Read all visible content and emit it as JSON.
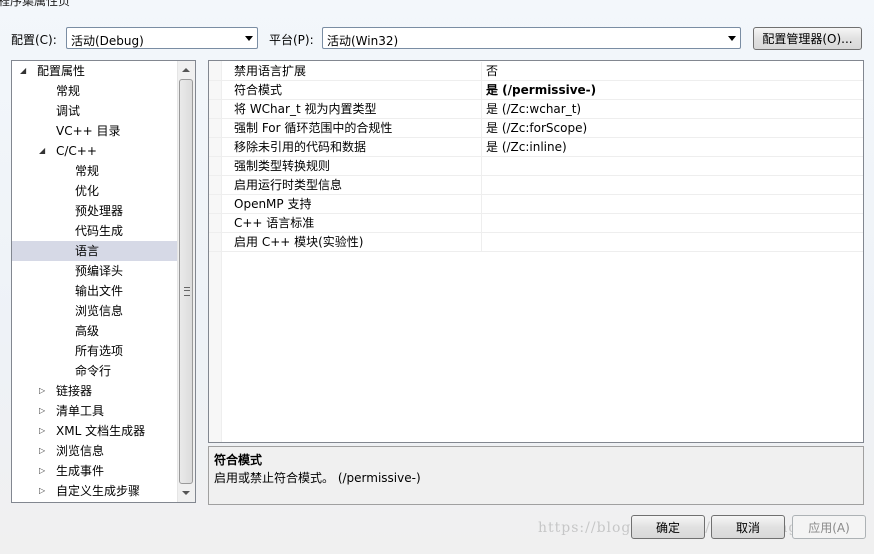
{
  "window": {
    "title": "程序集属性页"
  },
  "toolbar": {
    "config_label": "配置(C):",
    "config_value": "活动(Debug)",
    "platform_label": "平台(P):",
    "platform_value": "活动(Win32)",
    "config_manager_label": "配置管理器(O)..."
  },
  "tree": {
    "items": [
      {
        "label": "配置属性",
        "expander": "◢"
      },
      {
        "label": "常规"
      },
      {
        "label": "调试"
      },
      {
        "label": "VC++ 目录"
      },
      {
        "label": "C/C++",
        "expander": "◢"
      },
      {
        "label": "常规"
      },
      {
        "label": "优化"
      },
      {
        "label": "预处理器"
      },
      {
        "label": "代码生成"
      },
      {
        "label": "语言"
      },
      {
        "label": "预编译头"
      },
      {
        "label": "输出文件"
      },
      {
        "label": "浏览信息"
      },
      {
        "label": "高级"
      },
      {
        "label": "所有选项"
      },
      {
        "label": "命令行"
      },
      {
        "label": "链接器",
        "expander": "▷"
      },
      {
        "label": "清单工具",
        "expander": "▷"
      },
      {
        "label": "XML 文档生成器",
        "expander": "▷"
      },
      {
        "label": "浏览信息",
        "expander": "▷"
      },
      {
        "label": "生成事件",
        "expander": "▷"
      },
      {
        "label": "自定义生成步骤",
        "expander": "▷"
      }
    ]
  },
  "grid": {
    "rows": [
      {
        "name": "禁用语言扩展",
        "value": "否"
      },
      {
        "name": "符合模式",
        "value": "是 (/permissive-)"
      },
      {
        "name": "将 WChar_t 视为内置类型",
        "value": "是 (/Zc:wchar_t)"
      },
      {
        "name": "强制 For 循环范围中的合规性",
        "value": "是 (/Zc:forScope)"
      },
      {
        "name": "移除未引用的代码和数据",
        "value": "是 (/Zc:inline)"
      },
      {
        "name": "强制类型转换规则",
        "value": ""
      },
      {
        "name": "启用运行时类型信息",
        "value": ""
      },
      {
        "name": "OpenMP 支持",
        "value": ""
      },
      {
        "name": "C++ 语言标准",
        "value": ""
      },
      {
        "name": "启用 C++ 模块(实验性)",
        "value": ""
      }
    ]
  },
  "description": {
    "title": "符合模式",
    "text": "启用或禁止符合模式。    (/permissive-)"
  },
  "buttons": {
    "ok": "确定",
    "cancel": "取消",
    "apply": "应用(A)"
  },
  "watermark": "https://blog.csdn.net/qinshiyang"
}
